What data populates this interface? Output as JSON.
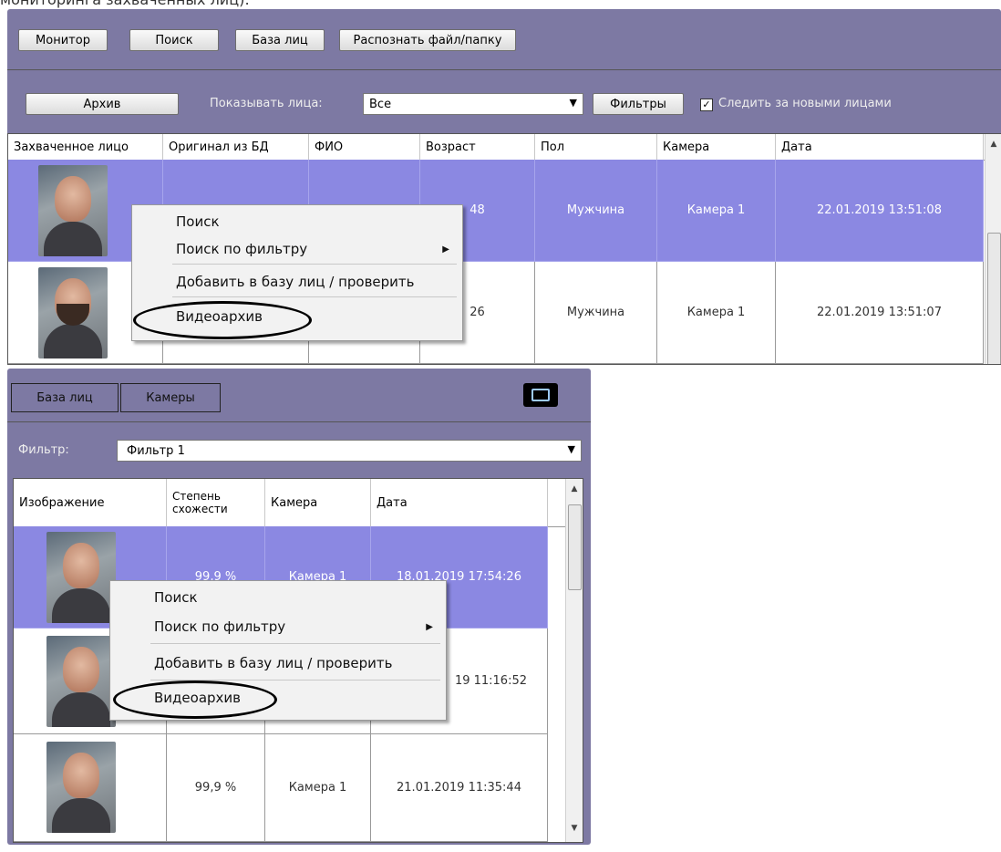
{
  "caption": "мониторинга захваченных лиц):",
  "top": {
    "toolbar": [
      "Монитор",
      "Поиск",
      "База лиц",
      "Распознать файл/папку"
    ],
    "archive_button": "Архив",
    "show_faces_label": "Показывать лица:",
    "show_faces_value": "Все",
    "filters_button": "Фильтры",
    "follow_label": "Следить за новыми лицами",
    "follow_checked": true,
    "columns": [
      "Захваченное лицо",
      "Оригинал из БД",
      "ФИО",
      "Возраст",
      "Пол",
      "Камера",
      "Дата"
    ],
    "rows": [
      {
        "age": "48",
        "gender": "Мужчина",
        "camera": "Камера 1",
        "date": "22.01.2019 13:51:08",
        "selected": true
      },
      {
        "age": "26",
        "gender": "Мужчина",
        "camera": "Камера 1",
        "date": "22.01.2019 13:51:07",
        "selected": false
      }
    ],
    "menu": [
      "Поиск",
      "Поиск по фильтру",
      "Добавить в базу лиц / проверить",
      "Видеоархив"
    ]
  },
  "bottom": {
    "tabs": [
      "База лиц",
      "Камеры"
    ],
    "printer_icon": "printer-icon",
    "filter_label": "Фильтр:",
    "filter_value": "Фильтр 1",
    "columns": [
      "Изображение",
      "Степень схожести",
      "Камера",
      "Дата"
    ],
    "rows": [
      {
        "similarity": "99,9 %",
        "camera": "Камера 1",
        "date": "18.01.2019 17:54:26",
        "selected": true
      },
      {
        "similarity": "",
        "camera": "",
        "date": "19 11:16:52",
        "selected": false
      },
      {
        "similarity": "99,9 %",
        "camera": "Камера 1",
        "date": "21.01.2019 11:35:44",
        "selected": false
      }
    ],
    "menu": [
      "Поиск",
      "Поиск по фильтру",
      "Добавить в базу лиц / проверить",
      "Видеоархив"
    ]
  },
  "colors": {
    "panel": "#7d79a3",
    "selected_row": "#8b88e2"
  }
}
